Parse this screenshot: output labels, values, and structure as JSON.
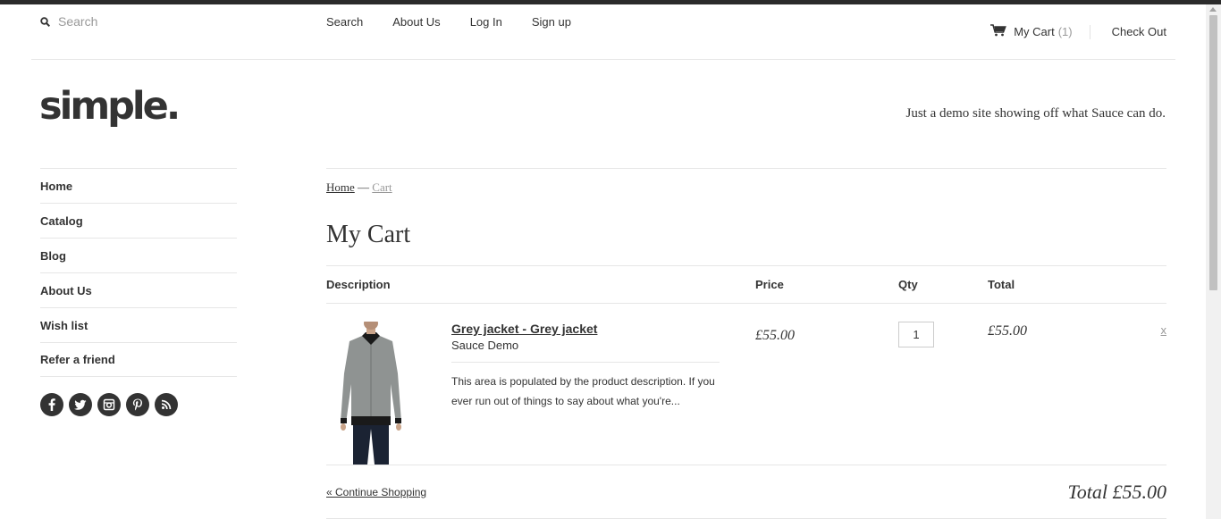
{
  "header": {
    "search_placeholder": "Search",
    "nav": [
      "Search",
      "About Us",
      "Log In",
      "Sign up"
    ],
    "cart_label": "My Cart",
    "cart_count": "(1)",
    "checkout_label": "Check Out"
  },
  "brand": {
    "logo": "simple.",
    "tagline": "Just a demo site showing off what Sauce can do."
  },
  "sidebar": {
    "items": [
      "Home",
      "Catalog",
      "Blog",
      "About Us",
      "Wish list",
      "Refer a friend"
    ],
    "social_icons": [
      "facebook-icon",
      "twitter-icon",
      "instagram-icon",
      "pinterest-icon",
      "rss-icon"
    ]
  },
  "breadcrumb": {
    "home": "Home",
    "separator": "—",
    "current": "Cart"
  },
  "page_title": "My Cart",
  "cart": {
    "columns": [
      "Description",
      "Price",
      "Qty",
      "Total"
    ],
    "items": [
      {
        "name": "Grey jacket - Grey jacket",
        "vendor": "Sauce Demo",
        "description": "This area is populated by the product description. If you ever run out of things to say about what you're...",
        "price": "£55.00",
        "qty": "1",
        "total": "£55.00",
        "remove": "x"
      }
    ],
    "continue_label": "« Continue Shopping",
    "grand_total": "Total £55.00"
  },
  "colors": {
    "text": "#333333",
    "muted": "#999999",
    "rule": "#e6e6e6",
    "topbar": "#2b2b2b"
  }
}
